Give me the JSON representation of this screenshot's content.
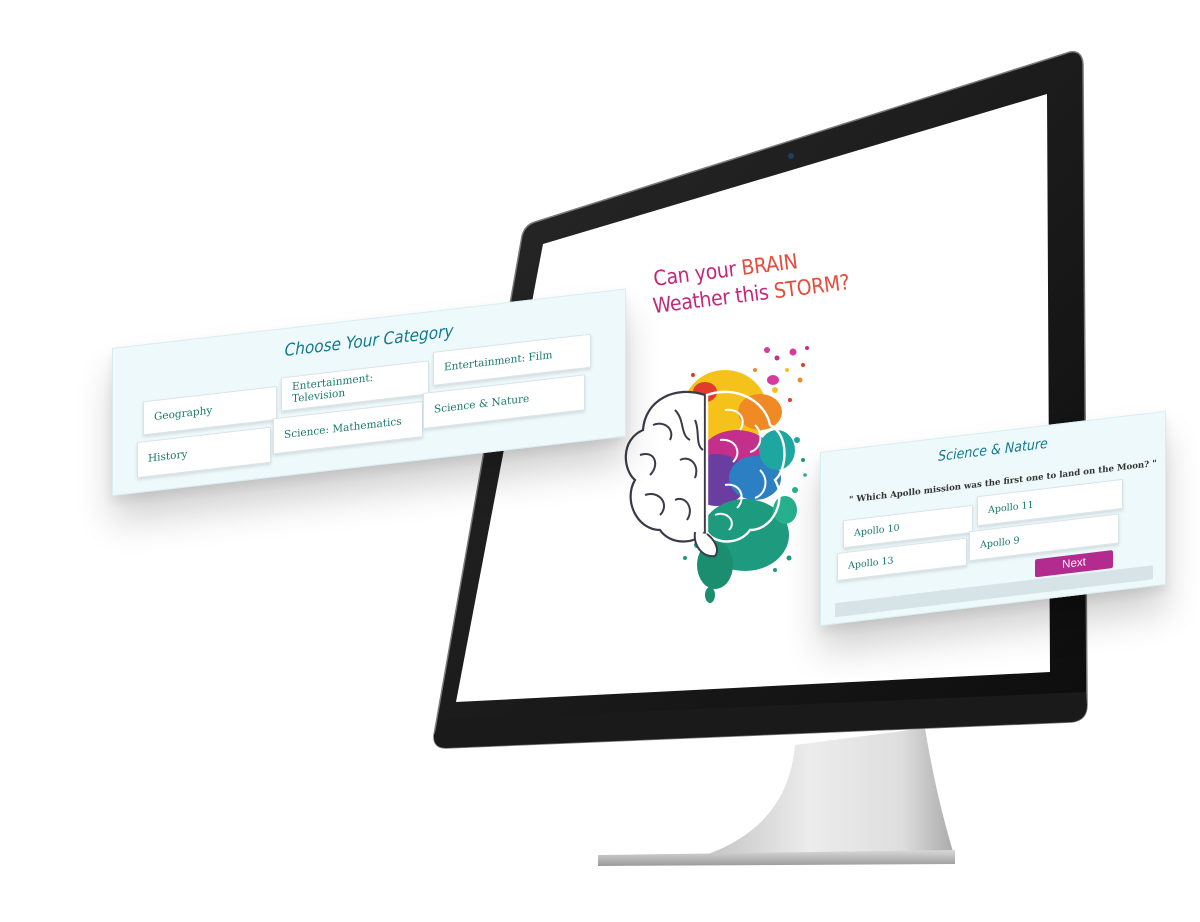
{
  "screen": {
    "tagline_line1_a": "Can your ",
    "tagline_line1_b": "BRAIN",
    "tagline_line2_a": "Weather this ",
    "tagline_line2_b": "STORM?"
  },
  "category_card": {
    "title": "Choose Your Category",
    "categories": [
      "Geography",
      "Entertainment: Television",
      "Entertainment: Film",
      "History",
      "Science: Mathematics",
      "Science & Nature"
    ]
  },
  "question_card": {
    "title": "Science & Nature",
    "question": "\" Which Apollo mission was the first one to land on the Moon? \"",
    "answers": [
      "Apollo 10",
      "Apollo 11",
      "Apollo 13",
      "Apollo 9"
    ],
    "next_label": "Next",
    "progress": 0
  },
  "colors": {
    "accent_magenta": "#b32b8f",
    "title_teal": "#127a8f",
    "tagline_pink": "#c2277a",
    "tagline_red": "#e64b3c",
    "card_bg": "#eef9fb"
  },
  "icons": [
    "brain-icon",
    "camera-icon"
  ]
}
